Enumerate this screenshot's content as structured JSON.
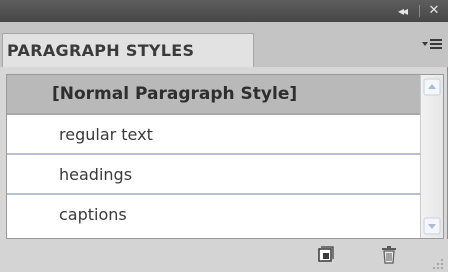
{
  "panel": {
    "title_controls": {
      "collapse_glyph": "◂◂",
      "close_glyph": "✕"
    },
    "tab": {
      "label": "PARAGRAPH STYLES"
    },
    "menu_icon": "panel-menu-icon",
    "styles": [
      {
        "label": "[Normal Paragraph Style]",
        "selected": true
      },
      {
        "label": "regular text",
        "selected": false
      },
      {
        "label": "headings",
        "selected": false
      },
      {
        "label": "captions",
        "selected": false
      }
    ],
    "footer_icons": [
      "new-style-icon",
      "delete-style-icon"
    ],
    "colors": {
      "titlebar": "#4f4f4f",
      "selected_row": "#b9b9b9",
      "row_divider": "#b9bfd0"
    }
  }
}
